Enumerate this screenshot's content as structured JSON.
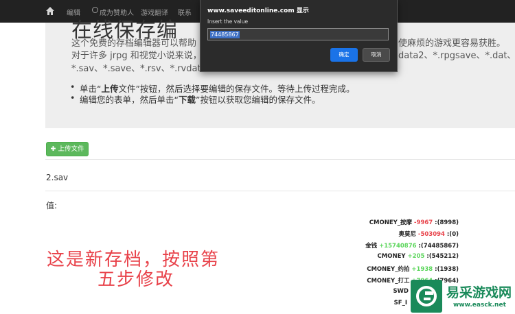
{
  "nav": {
    "items": [
      "编辑",
      "成为赞助人",
      "游戏翻译",
      "联系"
    ]
  },
  "hero": {
    "title": "在线保存编",
    "line1": "这个免费的存档编辑器可以帮助",
    "line1_tail": "使麻烦的游戏更容易获胜。",
    "line2": "对于许多 jrpg 和视觉小说来说，",
    "line2_tail": "data2、*.rpgsave、*.dat、",
    "line3": "*.sav、*.save、*.rsv、*.rvdata、",
    "bullet1_pre": "单击“",
    "bullet1_bold": "上传",
    "bullet1_post": "文件”按钮，然后选择要编辑的保存文件。等待上传过程完成。",
    "bullet2_pre": "编辑您的表单，然后单击“",
    "bullet2_bold": "下载",
    "bullet2_post": "”按钮以获取您编辑的保存文件。"
  },
  "upload_button": "上传文件",
  "filename": "2.sav",
  "value_label": "值:",
  "annotation": {
    "line1": "这是新存档，按照第",
    "line2": "五步修改"
  },
  "values": [
    {
      "name": "CMONEY_按摩",
      "delta": "-9967",
      "sign": "neg",
      "result": ":(8998)"
    },
    {
      "name": "奥莫尼",
      "delta": "-503094",
      "sign": "neg",
      "result": ":(0)"
    },
    {
      "name": "金钱",
      "delta": "+15740876",
      "sign": "pos",
      "result": ":(74485867)"
    },
    {
      "name": "CMONEY",
      "delta": "+205",
      "sign": "pos",
      "result": ":(545212)"
    },
    {
      "name": "CMONEY_约拍",
      "delta": "+1938",
      "sign": "pos",
      "result": ":(1938)"
    },
    {
      "name": "CMONEY_打工",
      "delta": "+7964",
      "sign": "pos",
      "result": ":(7964)"
    },
    {
      "name": "SWD",
      "delta": "",
      "sign": "",
      "result": ""
    },
    {
      "name": "SF_I",
      "delta": "",
      "sign": "",
      "result": ""
    }
  ],
  "dialog": {
    "title": "www.saveeditonline.com 显示",
    "message": "Insert the value",
    "input_value": "74485867",
    "ok_label": "确定",
    "cancel_label": "取消"
  },
  "watermark": {
    "text": "易采游戏网",
    "url": "www.easck.net"
  },
  "colors": {
    "navbar": "#222222",
    "upload_green": "#5cb85c",
    "negative": "#e8434a",
    "positive": "#5cd65c",
    "annotation_red": "#e8424a",
    "dialog_bg": "#2b2b2b",
    "ok_blue": "#1a73e8",
    "watermark_green": "#1a8a5a"
  }
}
